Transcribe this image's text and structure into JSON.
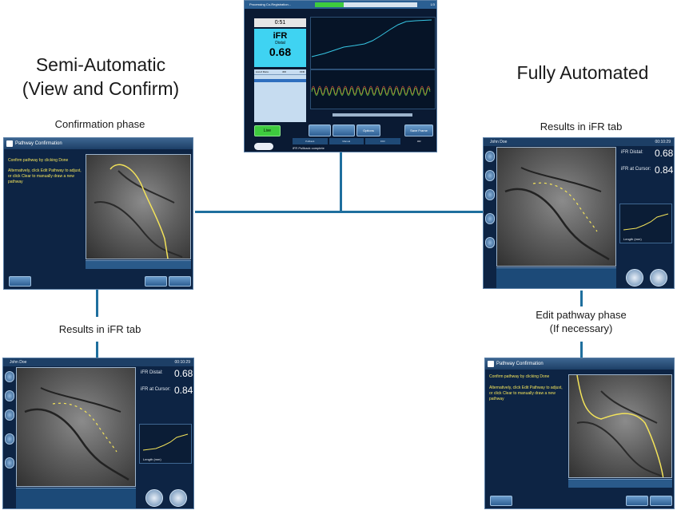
{
  "headings": {
    "semi_automatic": [
      "Semi-Automatic",
      "(View and Confirm)"
    ],
    "fully_automated": "Fully Automated",
    "confirmation_phase": "Confirmation phase",
    "results_left": "Results in iFR tab",
    "results_right": "Results in iFR tab",
    "edit_pathway": [
      "Edit pathway  phase",
      "(If necessary)"
    ]
  },
  "top_screen": {
    "title": "Processing Co-Registration...",
    "page_counter": "1/3",
    "timer": "0:51",
    "ifr_label": "iFR",
    "ifr_sub": "Distal",
    "ifr_value": "0.68",
    "list_header": [
      "List of Runs",
      "iFR",
      "FFR"
    ],
    "live_label": "Live",
    "options_label": "Options",
    "save_frame_label": "Save Frame",
    "status": "iFR Pullback complete",
    "tabs": [
      "Pullback",
      "Manual",
      "FFR",
      "iFR"
    ]
  },
  "confirm_panel": {
    "title": "Pathway Confirmation",
    "instruction_1": "Confirm pathway by clicking Done",
    "instruction_2": "Alternatively, click Edit Pathway to adjust, or click Clear to manually draw a new pathway"
  },
  "results_panel": {
    "patient": "John Doe",
    "time": "00:10:29",
    "ifr_distal_label": "iFR Distal:",
    "ifr_distal_value": "0.68",
    "ifr_cursor_label": "iFR at Cursor:",
    "ifr_cursor_value": "0.84",
    "chart_xlabel": "Length (mm)"
  },
  "colors": {
    "connector": "#1f6f9e",
    "panel_bg": "#0d2444",
    "ifr_box": "#3fd3f2",
    "pathway": "#f3e35a"
  }
}
